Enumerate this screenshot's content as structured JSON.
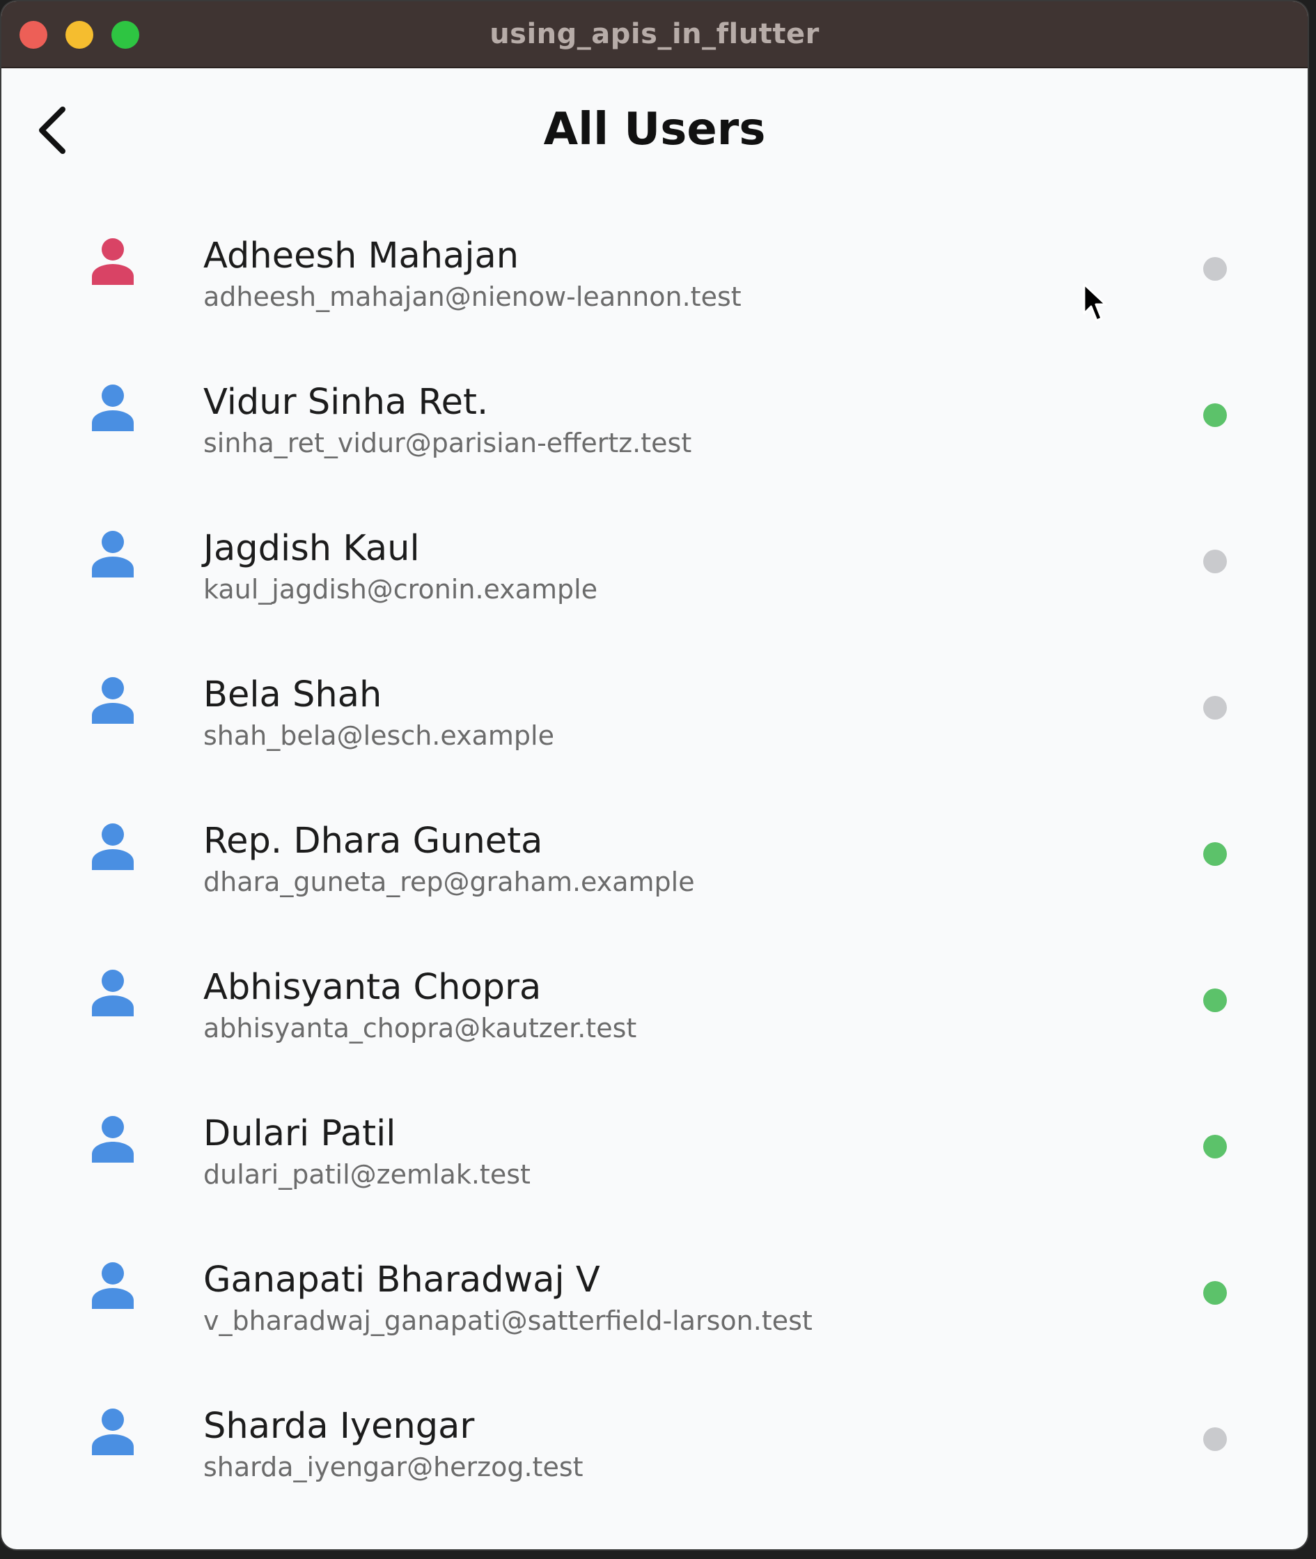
{
  "window": {
    "title": "using_apis_in_flutter"
  },
  "appbar": {
    "back_icon": "chevron-left-icon",
    "title": "All Users"
  },
  "colors": {
    "online": "#5cc26a",
    "offline": "#c9cacd",
    "female_avatar": "#d94365",
    "male_avatar": "#4a8fe2"
  },
  "users": [
    {
      "name": "Adheesh Mahajan",
      "email": "adheesh_mahajan@nienow-leannon.test",
      "avatar_color": "#d94365",
      "status": "offline"
    },
    {
      "name": "Vidur Sinha Ret.",
      "email": "sinha_ret_vidur@parisian-effertz.test",
      "avatar_color": "#4a8fe2",
      "status": "online"
    },
    {
      "name": "Jagdish Kaul",
      "email": "kaul_jagdish@cronin.example",
      "avatar_color": "#4a8fe2",
      "status": "offline"
    },
    {
      "name": "Bela Shah",
      "email": "shah_bela@lesch.example",
      "avatar_color": "#4a8fe2",
      "status": "offline"
    },
    {
      "name": "Rep. Dhara Guneta",
      "email": "dhara_guneta_rep@graham.example",
      "avatar_color": "#4a8fe2",
      "status": "online"
    },
    {
      "name": "Abhisyanta Chopra",
      "email": "abhisyanta_chopra@kautzer.test",
      "avatar_color": "#4a8fe2",
      "status": "online"
    },
    {
      "name": "Dulari Patil",
      "email": "dulari_patil@zemlak.test",
      "avatar_color": "#4a8fe2",
      "status": "online"
    },
    {
      "name": "Ganapati Bharadwaj V",
      "email": "v_bharadwaj_ganapati@satterfield-larson.test",
      "avatar_color": "#4a8fe2",
      "status": "online"
    },
    {
      "name": "Sharda Iyengar",
      "email": "sharda_iyengar@herzog.test",
      "avatar_color": "#4a8fe2",
      "status": "offline"
    }
  ]
}
